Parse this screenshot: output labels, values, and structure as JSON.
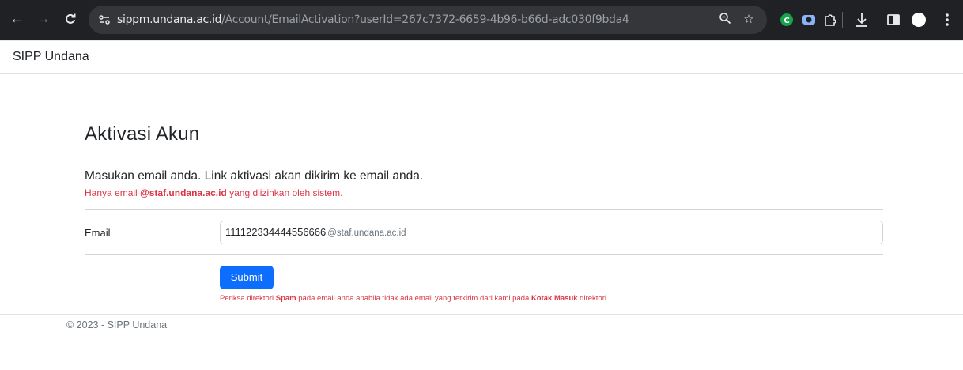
{
  "browser": {
    "url_host": "sippm.undana.ac.id",
    "url_path": "/Account/EmailActivation?userId=267c7372-6659-4b96-b66d-adc030f9bda4",
    "icons": [
      "back-icon",
      "forward-icon",
      "reload-icon",
      "site-info-icon",
      "zoom-icon",
      "bookmark-star-icon",
      "extension-c-icon",
      "extension-camera-icon",
      "extensions-puzzle-icon",
      "downloads-icon",
      "side-panel-icon",
      "profile-icon",
      "menu-icon"
    ]
  },
  "navbar": {
    "brand": "SIPP Undana"
  },
  "main": {
    "title": "Aktivasi Akun",
    "lead": "Masukan email anda. Link aktivasi akan dikirim ke email anda.",
    "note_prefix": "Hanya email ",
    "note_domain": "@staf.undana.ac.id",
    "note_suffix": " yang diizinkan oleh sistem.",
    "email_label": "Email",
    "email_value": "111122334444556666",
    "email_suffix": "@staf.undana.ac.id",
    "submit_label": "Submit",
    "help_1": "Periksa direktori ",
    "help_spam": "Spam",
    "help_2": " pada email anda apabila tidak ada email yang terkirim dari kami pada ",
    "help_inbox": "Kotak Masuk",
    "help_3": " direktori."
  },
  "footer": {
    "text": "© 2023 - SIPP Undana"
  },
  "colors": {
    "primary": "#0d6efd",
    "danger": "#dc3545",
    "chrome_bg": "#202124"
  }
}
